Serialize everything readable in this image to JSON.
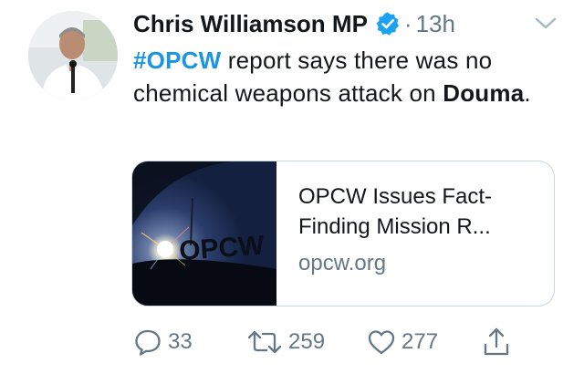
{
  "tweet": {
    "author_name": "Chris Williamson MP",
    "separator": "·",
    "timestamp": "13h",
    "text": {
      "hashtag": "#OPCW",
      "part1": " report says there was no chemical weapons attack on ",
      "place": "Douma",
      "end": "."
    }
  },
  "card": {
    "image_watermark": "OPCW",
    "title": "OPCW Issues Fact-Finding Mission R...",
    "domain": "opcw.org"
  },
  "actions": {
    "replies": "33",
    "retweets": "259",
    "likes": "277"
  },
  "icons": {
    "verified": "verified-badge-icon",
    "menu": "chevron-down-icon",
    "reply": "reply-icon",
    "retweet": "retweet-icon",
    "like": "heart-icon",
    "share": "share-icon"
  },
  "colors": {
    "link": "#1b95e0",
    "verified": "#1da1f2",
    "muted": "#657786",
    "text": "#14171a"
  }
}
